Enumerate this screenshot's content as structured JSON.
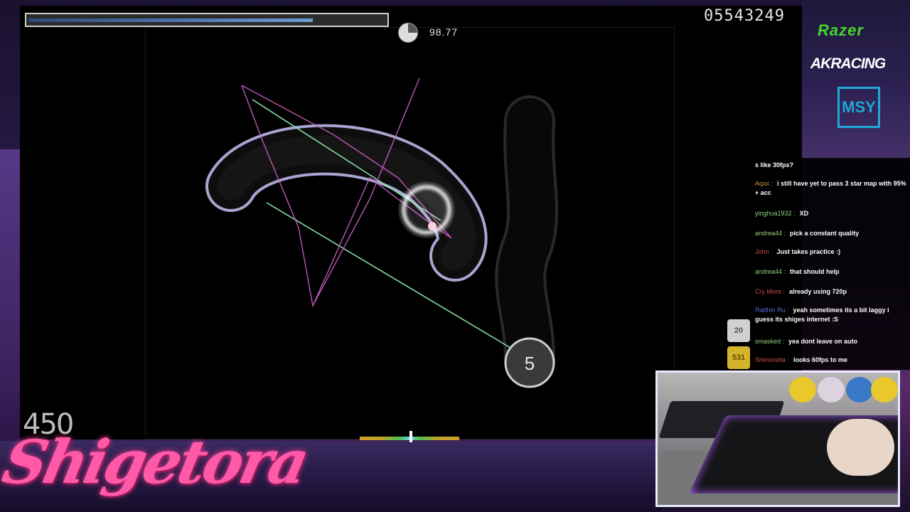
{
  "hud": {
    "health_fraction": 0.8,
    "accuracy": "98.77",
    "score": "05543249",
    "combo": "450",
    "approach_number": "5"
  },
  "sponsors": {
    "razer": "Razer",
    "akracing": "AKRACING",
    "msy": "MSY"
  },
  "chat": {
    "messages": [
      {
        "user": "",
        "user_color": "#ffffff",
        "text": "s like 30fps?"
      },
      {
        "user": "Aqxx",
        "user_color": "#d4963a",
        "text": "i still have yet to pass 3 star map with 95% + acc"
      },
      {
        "user": "yinghua1932",
        "user_color": "#8fd47a",
        "text": "XD"
      },
      {
        "user": "andrea44",
        "user_color": "#8fd47a",
        "text": "pick a constant quality"
      },
      {
        "user": "John",
        "user_color": "#d04a4a",
        "text": "Just takes practice :)"
      },
      {
        "user": "andrea44",
        "user_color": "#8fd47a",
        "text": "that should help"
      },
      {
        "user": "Cry More",
        "user_color": "#d04a4a",
        "text": "already using 720p"
      },
      {
        "user": "Ratthin Ru",
        "user_color": "#5a6ad8",
        "text": "yeah sometimes its a bit laggy i guess its shiges internet :S"
      },
      {
        "user": "smasked",
        "user_color": "#8fd47a",
        "text": "yea dont leave on auto"
      },
      {
        "user": "Shimoneta",
        "user_color": "#d04a4a",
        "text": "looks 60fps to me"
      }
    ]
  },
  "badges": {
    "badge_20": "20",
    "badge_531": "531"
  },
  "brand": {
    "name": "Shigetora"
  },
  "colors": {
    "slider_border": "#b8b8e8",
    "follow_point_green": "#8ae8a8",
    "cursor_trail_pink": "#d060c8",
    "razer_green": "#44d62c",
    "msy_blue": "#1da8d8",
    "brand_pink": "#ff5aa8"
  }
}
